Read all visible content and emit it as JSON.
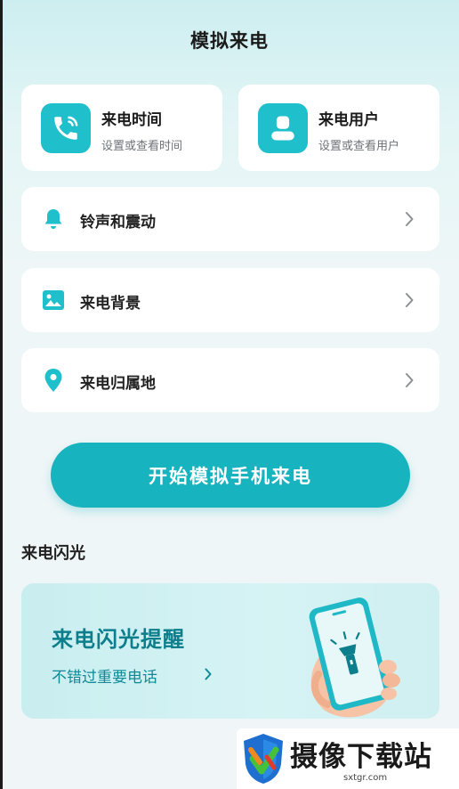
{
  "header": {
    "title": "模拟来电"
  },
  "top_cards": [
    {
      "title": "来电时间",
      "subtitle": "设置或查看时间",
      "icon": "phone-ringing-icon"
    },
    {
      "title": "来电用户",
      "subtitle": "设置或查看用户",
      "icon": "user-icon"
    }
  ],
  "settings": [
    {
      "label": "铃声和震动",
      "icon": "bell-icon"
    },
    {
      "label": "来电背景",
      "icon": "image-icon"
    },
    {
      "label": "来电归属地",
      "icon": "location-pin-icon"
    }
  ],
  "start_button": {
    "label": "开始模拟手机来电"
  },
  "flash_section": {
    "title": "来电闪光",
    "banner_title": "来电闪光提醒",
    "banner_subtitle": "不错过重要电话",
    "illustration": "hand-phone-flashlight-icon"
  },
  "watermark": {
    "text": "摄像下载站",
    "url": "sxtgr.com"
  },
  "colors": {
    "accent": "#17b3bf",
    "icon_teal": "#20bfcc",
    "banner_text": "#0d7f8c"
  }
}
